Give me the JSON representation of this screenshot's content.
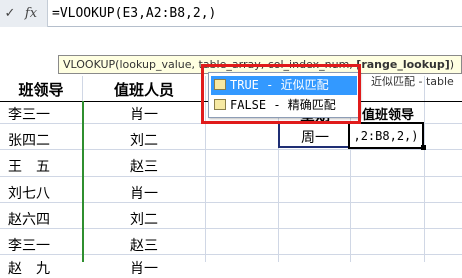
{
  "formula_bar": {
    "cancel_glyph": "✓",
    "fx_label": "fx",
    "formula": "=VLOOKUP(E3,A2:B8,2,)"
  },
  "screentip": {
    "prefix": "VLOOKUP(lookup_value, table_array, col_index_num, ",
    "current_arg": "[range_lookup]",
    "suffix": ")"
  },
  "autocomplete": {
    "items": [
      {
        "label": "TRUE - 近似匹配",
        "selected": true,
        "icon": "formula-constant-icon"
      },
      {
        "label": "FALSE - 精确匹配",
        "selected": false,
        "icon": "formula-constant-icon"
      }
    ],
    "side_hint": "近似匹配 - table"
  },
  "table": {
    "headers": [
      "班领导",
      "值班人员"
    ],
    "rows": [
      [
        "李三一",
        "肖一"
      ],
      [
        "张四二",
        "刘二"
      ],
      [
        "王　五",
        "赵三"
      ],
      [
        "刘七八",
        "肖一"
      ],
      [
        "赵六四",
        "刘二"
      ],
      [
        "李三一",
        "赵三"
      ],
      [
        "赵　九",
        "肖一"
      ]
    ]
  },
  "lookup": {
    "header_week": "星期",
    "header_leader": "值班领导",
    "week_value": "周一",
    "formula_tail": ",2:B8,2,)"
  },
  "colors": {
    "accent": "#3399ff",
    "highlight": "#e01b1b",
    "tooltip_bg": "#ffffe1"
  }
}
